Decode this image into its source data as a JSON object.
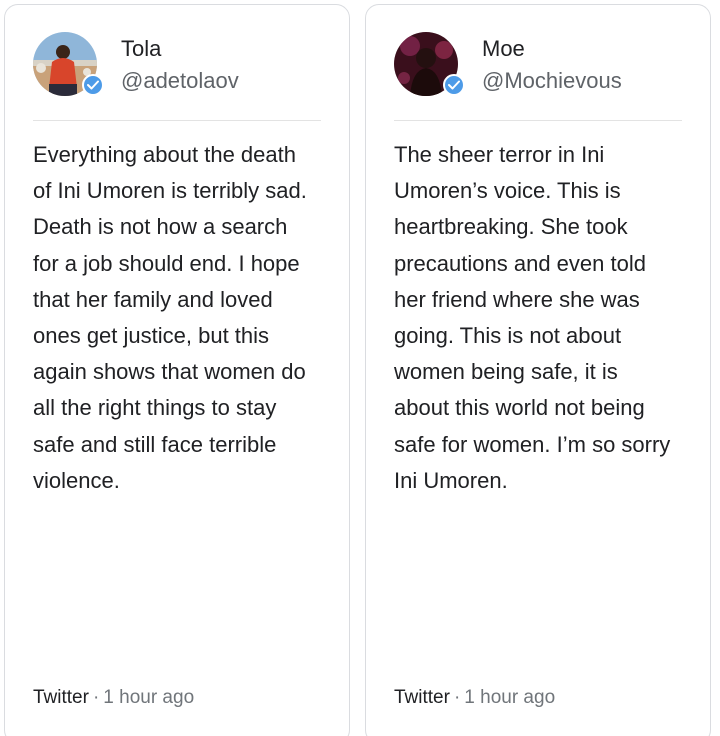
{
  "posts": [
    {
      "name": "Tola",
      "handle": "@adetolaov",
      "avatar_icon": "profile-photo",
      "verified_icon": "verified-badge-icon",
      "lines": [
        "Everything about the death",
        "of Ini Umoren is terribly sad.",
        "Death is not how a search",
        "for a job should end. I hope",
        "that her family and loved",
        "ones get justice, but this",
        "again shows that women do",
        "all the right things to stay",
        "safe and still face terrible",
        "violence."
      ],
      "source": "Twitter",
      "separator": "·",
      "time": "1 hour ago"
    },
    {
      "name": "Moe",
      "handle": "@Mochievous",
      "avatar_icon": "profile-photo",
      "verified_icon": "verified-badge-icon",
      "lines": [
        "The sheer terror in Ini",
        "Umoren’s voice. This is",
        "heartbreaking. She took",
        "precautions and even told",
        "her friend where she was",
        "going. This is not about",
        "women being safe, it is",
        "about this world not being",
        "safe for women. I’m so sorry",
        "Ini Umoren."
      ],
      "source": "Twitter",
      "separator": "·",
      "time": "1 hour ago"
    }
  ],
  "colors": {
    "verified_badge": "#4d9be8",
    "card_border": "#dadce0",
    "secondary_text": "#5f6368"
  }
}
